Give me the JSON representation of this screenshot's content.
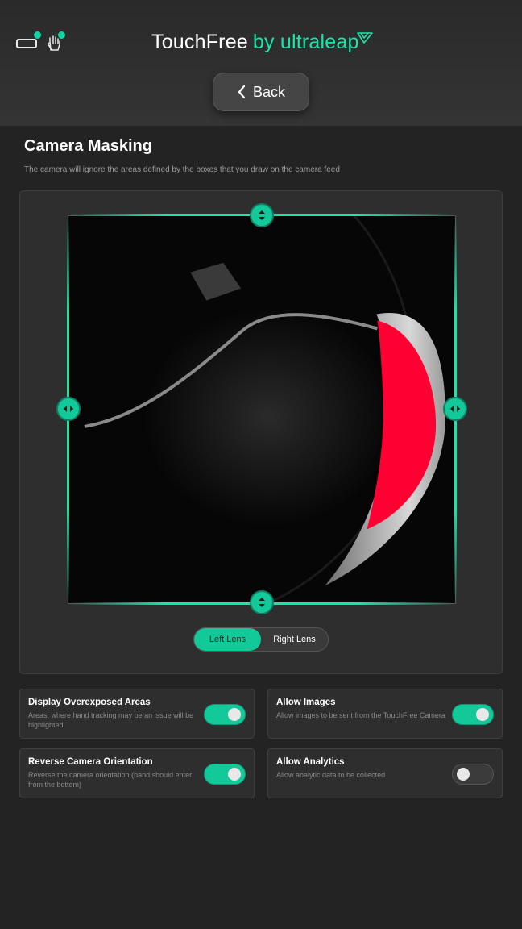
{
  "header": {
    "brand_name": "TouchFree",
    "brand_by": "by",
    "brand_company": "ultraleap",
    "back_label": "Back",
    "accent_color": "#17e6a9"
  },
  "masking": {
    "title": "Camera Masking",
    "description": "The camera will ignore the areas defined by the boxes that you draw on the camera feed",
    "lens_options": [
      "Left Lens",
      "Right Lens"
    ],
    "selected_lens": "Left Lens"
  },
  "settings": [
    {
      "title": "Display Overexposed Areas",
      "description": "Areas, where hand tracking may be an issue will be highlighted",
      "enabled": true
    },
    {
      "title": "Allow Images",
      "description": "Allow images to be sent from the TouchFree Camera",
      "enabled": true
    },
    {
      "title": "Reverse Camera Orientation",
      "description": "Reverse the camera orientation (hand should enter from the bottom)",
      "enabled": true
    },
    {
      "title": "Allow Analytics",
      "description": "Allow analytic data to be collected",
      "enabled": false
    }
  ],
  "colors": {
    "toggle_on": "#13c99a",
    "overexposed": "#ff0033"
  }
}
